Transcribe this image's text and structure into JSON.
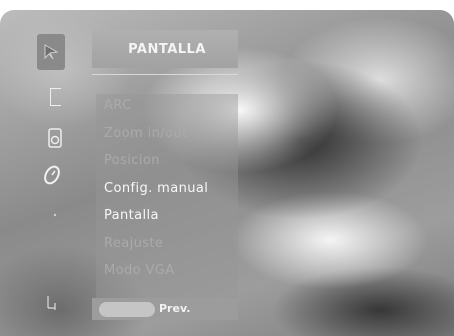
{
  "menu": {
    "title": "PANTALLA",
    "items": [
      {
        "label": "ARC",
        "active": false
      },
      {
        "label": "Zoom in/out",
        "active": false
      },
      {
        "label": "Posicion",
        "active": false
      },
      {
        "label": "Config. manual",
        "active": true
      },
      {
        "label": "Pantalla",
        "active": true
      },
      {
        "label": "Reajuste",
        "active": false
      },
      {
        "label": "Modo VGA",
        "active": false
      }
    ]
  },
  "footer": {
    "prev_label": "Prev."
  },
  "side_icons": [
    "picture-icon",
    "setup-icon",
    "audio-icon",
    "time-icon",
    "option-icon",
    "lock-icon"
  ]
}
